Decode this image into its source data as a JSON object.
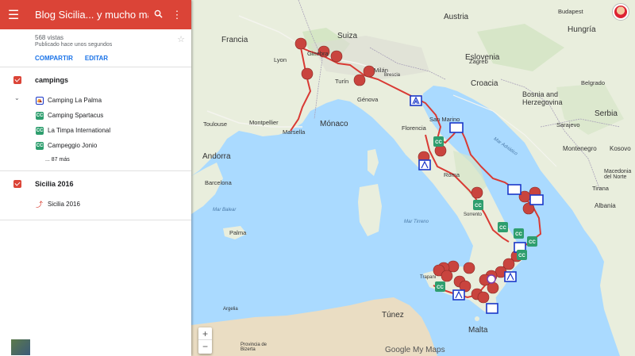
{
  "header": {
    "title": "Blog Sicilia... y mucho más",
    "menu_icon": "menu-icon",
    "search_icon": "search-icon",
    "more_icon": "more-vert-icon"
  },
  "meta": {
    "views": "568 vistas",
    "published": "Publicado hace unos segundos",
    "share_label": "COMPARTIR",
    "edit_label": "EDITAR"
  },
  "layers": [
    {
      "name": "campings",
      "items": [
        {
          "label": "Camping La Palma",
          "icon": "camping-icon"
        },
        {
          "label": "Camping Spartacus",
          "icon": "cc-icon"
        },
        {
          "label": "La Timpa International",
          "icon": "cc-icon"
        },
        {
          "label": "Campeggio Jonio",
          "icon": "cc-icon"
        }
      ],
      "more": "... 87 más"
    },
    {
      "name": "Sicilia 2016",
      "items": [
        {
          "label": "Sicilia 2016",
          "icon": "route-icon"
        }
      ]
    }
  ],
  "map": {
    "labels": {
      "francia": "Francia",
      "suiza": "Suiza",
      "austria": "Austria",
      "hungria": "Hungría",
      "eslovenia": "Eslovenia",
      "croacia": "Croacia",
      "bosnia": "Bosnia and Herzegovina",
      "serbia": "Serbia",
      "montenegro": "Montenegro",
      "kosovo": "Kosovo",
      "macedonia": "Macedonia del Norte",
      "albania": "Albania",
      "andorra": "Andorra",
      "monaco": "Mónaco",
      "san_marino": "San Marino",
      "malta": "Malta",
      "tunez": "Túnez",
      "lyon": "Lyon",
      "ginebra": "Ginebra",
      "turin": "Turín",
      "genova": "Génova",
      "milan": "Milán",
      "brescia": "Brescia",
      "toulouse": "Toulouse",
      "montpellier": "Montpellier",
      "marsella": "Marsella",
      "barcelona": "Barcelona",
      "palma": "Palma",
      "florencia": "Florencia",
      "roma": "Roma",
      "sorrento": "Sorrento",
      "zagreb": "Zagreb",
      "budapest": "Budapest",
      "belgrado": "Belgrado",
      "sarajevo": "Sarajevo",
      "tirana": "Tirana",
      "trapani": "Trapani",
      "mar_balear": "Mar Balear",
      "mar_tirreno": "Mar Tirreno",
      "mar_adriatico": "Mar Adriático",
      "provincia": "Provincia de Bizerta",
      "argelia_bottom": "Argelia"
    },
    "zoom_in": "+",
    "zoom_out": "−",
    "logo": "Google My Maps"
  },
  "colors": {
    "header": "#db4437",
    "route": "#d93a34",
    "pin": "#c9443e",
    "camp_marker": "#1a37c8",
    "cc_marker": "#2e9e6e",
    "sea": "#aadaff",
    "land": "#e8eddc"
  }
}
